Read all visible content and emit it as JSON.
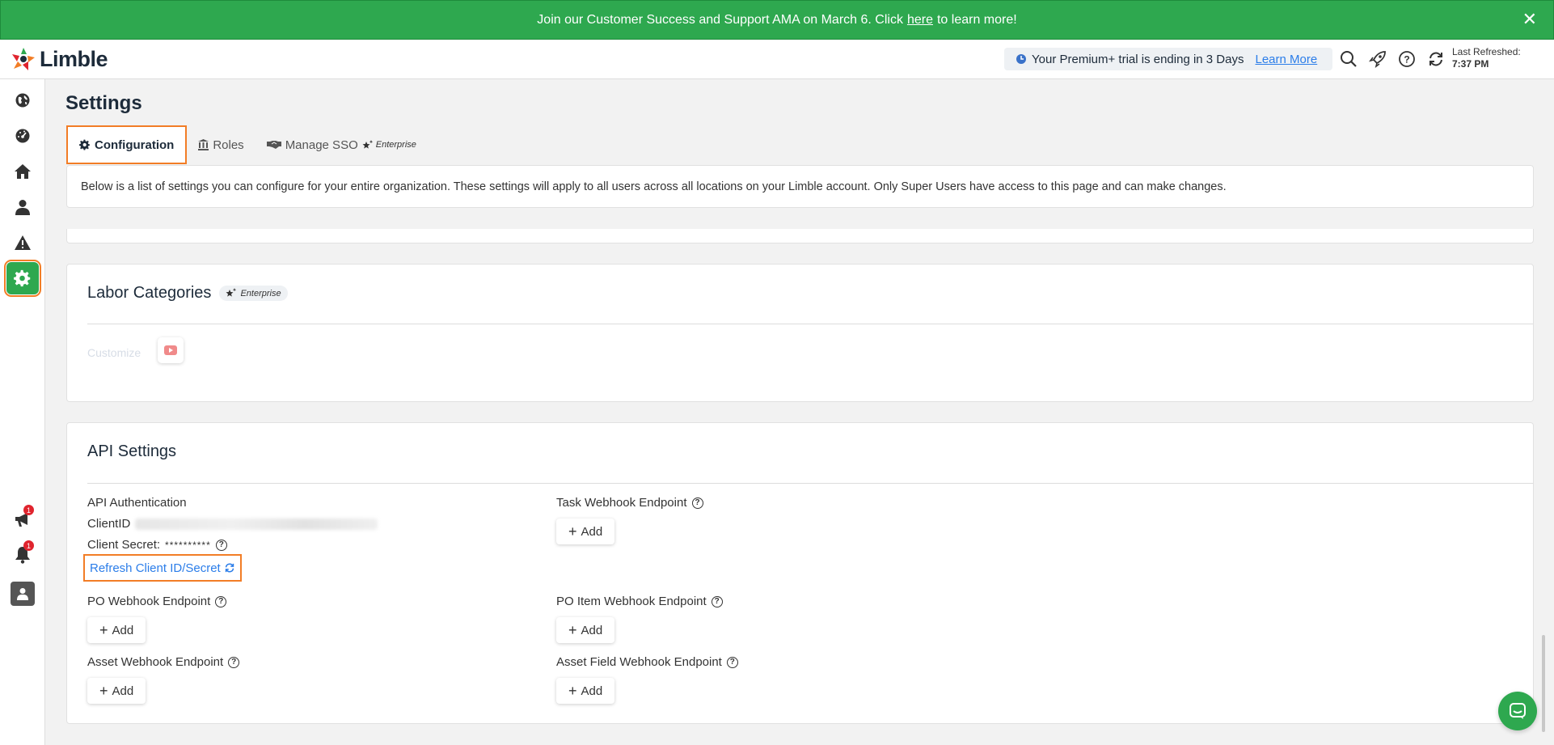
{
  "banner": {
    "text_before": "Join our Customer Success and Support AMA on March 6. Click",
    "link": "here",
    "text_after": "to learn more!",
    "close": "✕"
  },
  "header": {
    "logo": "Limble",
    "trial_text": "Your Premium+ trial is ending in 3 Days",
    "learn_more": "Learn More",
    "last_refreshed_label": "Last Refreshed:",
    "last_refreshed_time": "7:37 PM"
  },
  "sidebar": {
    "items": [
      {
        "icon": "globe-icon"
      },
      {
        "icon": "dashboard-icon"
      },
      {
        "icon": "home-icon"
      },
      {
        "icon": "user-icon"
      },
      {
        "icon": "warning-icon"
      },
      {
        "icon": "gear-icon",
        "active": true
      }
    ],
    "bottom": [
      {
        "icon": "megaphone-icon",
        "badge": "1"
      },
      {
        "icon": "bell-icon",
        "badge": "1"
      },
      {
        "icon": "profile-icon"
      }
    ]
  },
  "page": {
    "title": "Settings",
    "tabs": [
      {
        "label": "Configuration",
        "icon": "gear-icon",
        "active": true
      },
      {
        "label": "Roles",
        "icon": "bank-icon"
      },
      {
        "label": "Manage SSO",
        "icon": "handshake-icon"
      }
    ],
    "enterprise_tag": "Enterprise",
    "intro": "Below is a list of settings you can configure for your entire organization. These settings will apply to all users across all locations on your Limble account. Only Super Users have access to this page and can make changes."
  },
  "labor_categories": {
    "title": "Labor Categories",
    "enterprise_tag": "Enterprise",
    "customize_label": "Customize"
  },
  "api_settings": {
    "title": "API Settings",
    "api_authentication": "API Authentication",
    "client_id_label": "ClientID",
    "client_secret_label": "Client Secret:",
    "client_secret_value": "**********",
    "refresh_link": "Refresh Client ID/Secret",
    "task_webhook": "Task Webhook Endpoint",
    "po_webhook": "PO Webhook Endpoint",
    "po_item_webhook": "PO Item Webhook Endpoint",
    "asset_webhook": "Asset Webhook Endpoint",
    "asset_field_webhook": "Asset Field Webhook Endpoint",
    "add_label": "Add",
    "help_glyph": "?"
  },
  "colors": {
    "brand_green": "#2ea84f",
    "highlight_orange": "#f27d26",
    "link_blue": "#2b7de9"
  }
}
